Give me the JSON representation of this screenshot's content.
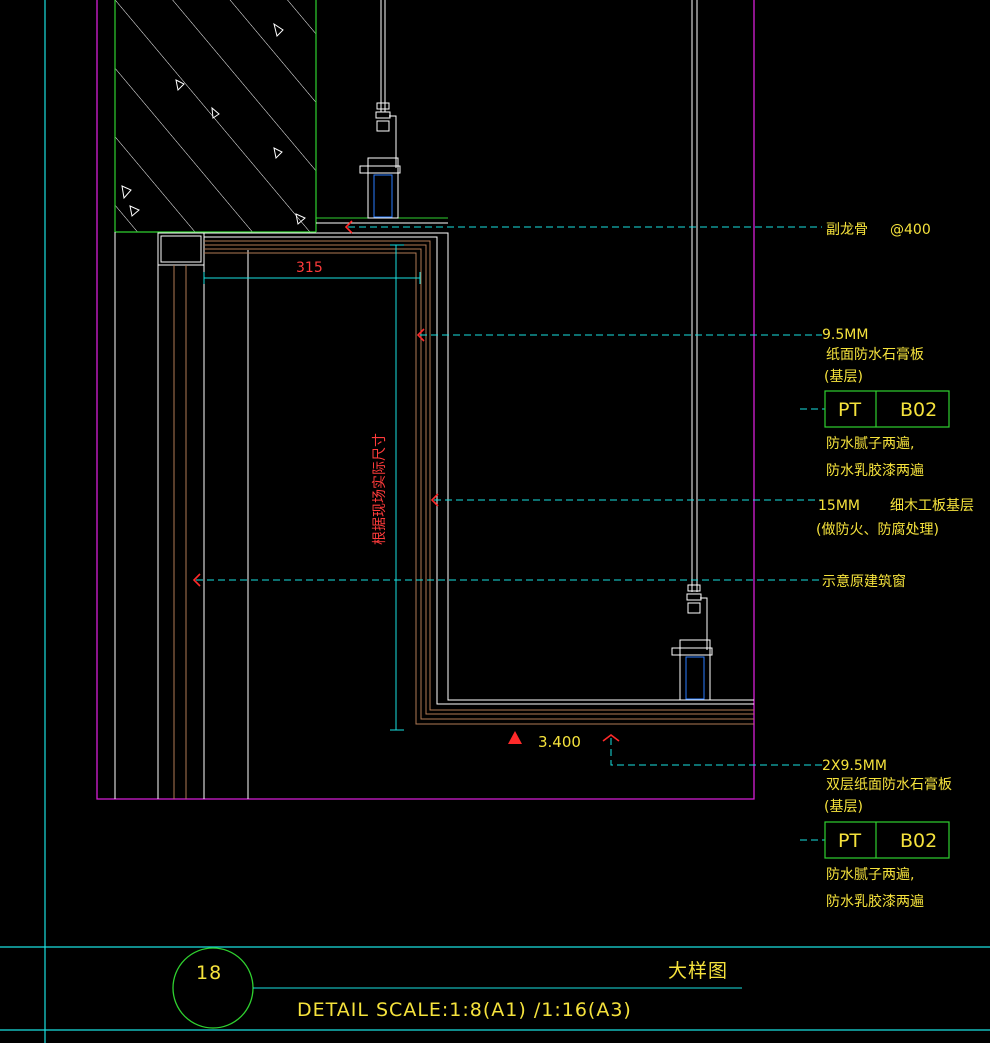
{
  "annotations": {
    "secondary_joist": "副龙骨",
    "secondary_joist_spacing": "@400",
    "board1_thickness": "9.5MM",
    "board1_name": "纸面防水石膏板",
    "board1_note": "(基层)",
    "tag1_code": "PT",
    "tag1_ref": "B02",
    "finish1_line1": "防水腻子两遍,",
    "finish1_line2": "防水乳胶漆两遍",
    "board2_thickness": "15MM",
    "board2_name": "细木工板基层",
    "board2_note": "(做防火、防腐处理)",
    "window_note": "示意原建筑窗",
    "board3_thickness": "2X9.5MM",
    "board3_name": "双层纸面防水石膏板",
    "board3_note": "(基层)",
    "tag2_code": "PT",
    "tag2_ref": "B02",
    "finish2_line1": "防水腻子两遍,",
    "finish2_line2": "防水乳胶漆两遍"
  },
  "dimensions": {
    "width_315": "315",
    "vertical_note": "根据现场实际尺寸",
    "level": "3.400"
  },
  "title_block": {
    "number": "18",
    "name": "大样图",
    "scale": "DETAIL SCALE:1:8(A1) /1:16(A3)"
  },
  "colors": {
    "background": "#000000",
    "frame_cyan": "#19e0e0",
    "magenta": "#d61fd6",
    "green": "#2fd02f",
    "yellow": "#f5e23c",
    "red": "#ff2a2a",
    "white": "#ffffff",
    "brown": "#b07a55",
    "blue": "#2a7cff"
  }
}
